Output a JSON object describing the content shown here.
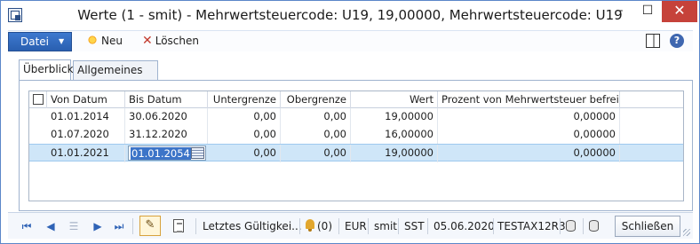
{
  "window": {
    "title": "Werte (1 - smit) - Mehrwertsteuercode: U19, 19,00000, Mehrwertsteuercode: U19"
  },
  "toolbar": {
    "datei_label": "Datei",
    "neu_label": "Neu",
    "loeschen_label": "Löschen"
  },
  "tabs": [
    {
      "label": "Überblick",
      "active": true
    },
    {
      "label": "Allgemeines",
      "active": false
    }
  ],
  "grid": {
    "columns": [
      "Von Datum",
      "Bis Datum",
      "Untergrenze",
      "Obergrenze",
      "Wert",
      "Prozent von Mehrwertsteuer befreit"
    ],
    "rows": [
      {
        "von": "01.01.2014",
        "bis": "30.06.2020",
        "unter": "0,00",
        "ober": "0,00",
        "wert": "19,00000",
        "prozent": "0,00000"
      },
      {
        "von": "01.07.2020",
        "bis": "31.12.2020",
        "unter": "0,00",
        "ober": "0,00",
        "wert": "16,00000",
        "prozent": "0,00000"
      },
      {
        "von": "01.01.2021",
        "bis": "01.01.2054",
        "unter": "0,00",
        "ober": "0,00",
        "wert": "19,00000",
        "prozent": "0,00000"
      }
    ],
    "selected_row": 2
  },
  "status": {
    "letztes": "Letztes Gültigkei...",
    "notifications": "(0)",
    "currency": "EUR",
    "company": "smit",
    "layer": "SST",
    "date": "05.06.2020",
    "host": "TESTAX12R3",
    "close_label": "Schließen"
  },
  "colors": {
    "accent": "#2a5fb0",
    "close": "#c6423a",
    "selection": "#cfe6f8"
  }
}
